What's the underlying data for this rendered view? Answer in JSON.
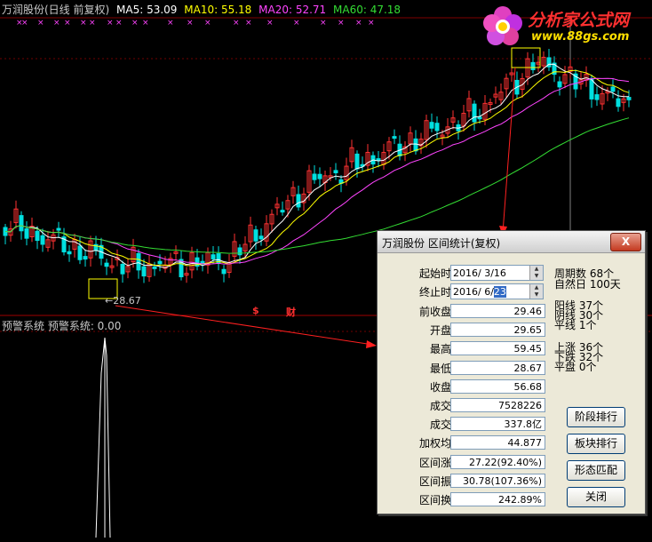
{
  "header": {
    "stock": "万润股份(日线 前复权)",
    "ma5": "MA5: 53.09",
    "ma10": "MA10: 55.18",
    "ma20": "MA20: 52.71",
    "ma60": "MA60: 47.18"
  },
  "colors": {
    "ma5": "#ffffff",
    "ma10": "#ffff00",
    "ma20": "#ff44ff",
    "ma60": "#33dd33",
    "up": "#ff3232",
    "down": "#00e0e0",
    "arrow": "#ff2020"
  },
  "logo": {
    "name": "分析家公式网",
    "url": "www.88gs.com"
  },
  "chart": {
    "low_label": "←28.67",
    "markers": [
      "$",
      "财"
    ]
  },
  "indicator": {
    "title": "预警系统  预警系统: 0.00"
  },
  "dialog": {
    "title": "万润股份 区间统计(复权)",
    "close_label": "X",
    "start_label": "起始时间",
    "start_value": "2016/ 3/16",
    "end_label": "终止时间",
    "end_value_prefix": "2016/ 6/",
    "end_value_day": "23",
    "fields": [
      {
        "label": "前收盘价",
        "value": "29.46"
      },
      {
        "label": "开盘价",
        "value": "29.65"
      },
      {
        "label": "最高价",
        "value": "59.45"
      },
      {
        "label": "最低价",
        "value": "28.67"
      },
      {
        "label": "收盘价",
        "value": "56.68"
      },
      {
        "label": "成交量",
        "value": "7528226"
      },
      {
        "label": "成交额",
        "value": "337.8亿"
      },
      {
        "label": "加权均价",
        "value": "44.877"
      },
      {
        "label": "区间涨幅",
        "value": "27.22(92.40%)"
      },
      {
        "label": "区间振幅",
        "value": "30.78(107.36%)"
      },
      {
        "label": "区间换手",
        "value": "242.89%"
      }
    ],
    "stats": {
      "weeks": "周期数  68个",
      "days": "自然日  100天",
      "yang": "阳线  37个",
      "yin": "阴线  30个",
      "flat": "平线  1个",
      "rise": "上涨  36个",
      "fall": "下跌  32个",
      "even": "平盘  0个"
    },
    "buttons": [
      "阶段排行",
      "板块排行",
      "形态匹配",
      "关闭"
    ]
  }
}
